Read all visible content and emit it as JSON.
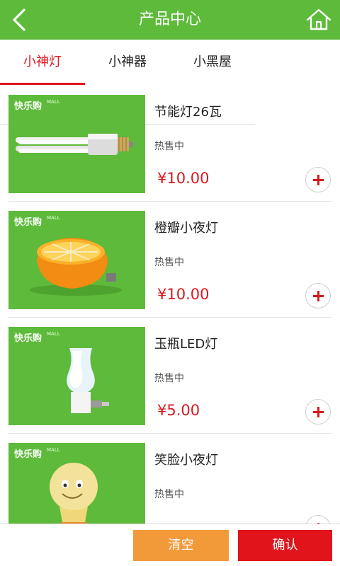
{
  "header": {
    "title": "产品中心",
    "back_icon": "chevron-left-icon",
    "home_icon": "home-icon",
    "bg_color": "#5dba3a"
  },
  "tabs": [
    {
      "label": "小神灯",
      "active": true
    },
    {
      "label": "小神器",
      "active": false
    },
    {
      "label": "小黑屋",
      "active": false
    }
  ],
  "products": [
    {
      "name": "节能灯26瓦",
      "status": "热售中",
      "price": "¥10.00",
      "image": "cfl-bulb"
    },
    {
      "name": "橙瓣小夜灯",
      "status": "热售中",
      "price": "¥10.00",
      "image": "orange-night-light"
    },
    {
      "name": "玉瓶LED灯",
      "status": "热售中",
      "price": "¥5.00",
      "image": "vase-led-light"
    },
    {
      "name": "笑脸小夜灯",
      "status": "热售中",
      "price": "",
      "image": "smiley-night-light"
    }
  ],
  "thumb_brand": "快乐购",
  "thumb_brand_sub": "MALL",
  "bottom": {
    "clear_label": "清空",
    "confirm_label": "确认"
  },
  "colors": {
    "accent_red": "#e0161b",
    "price_red": "#d71920",
    "clear_orange": "#f29a3a",
    "brand_green": "#5dba3a"
  }
}
